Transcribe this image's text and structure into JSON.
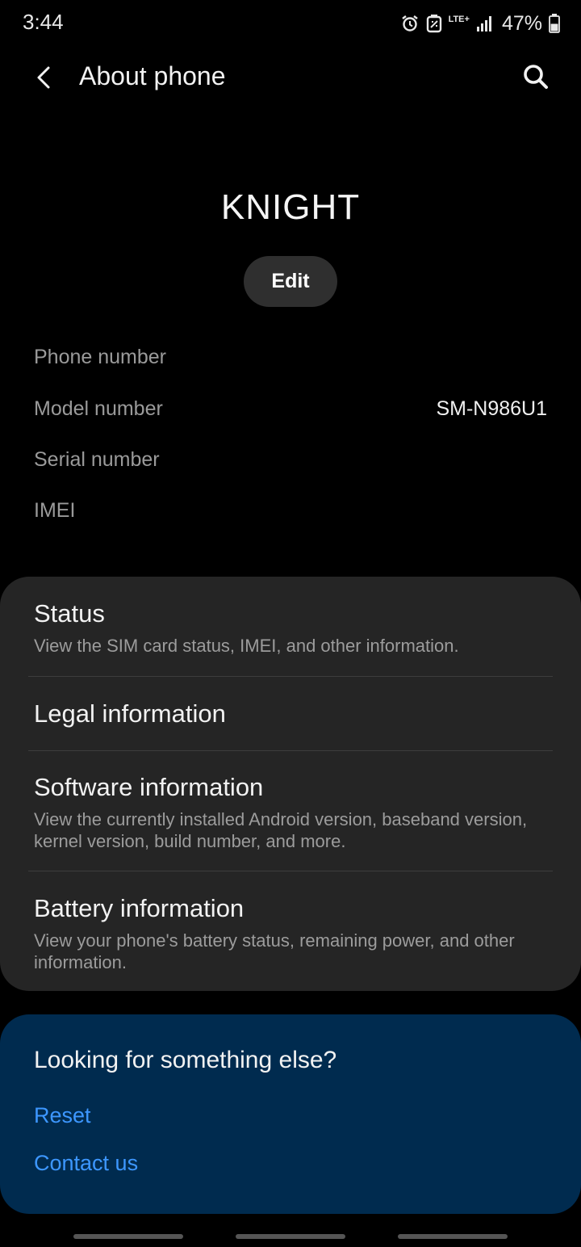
{
  "status_bar": {
    "time": "3:44",
    "network": "LTE+",
    "battery": "47%"
  },
  "header": {
    "title": "About phone"
  },
  "device": {
    "name": "KNIGHT",
    "edit_label": "Edit"
  },
  "info": [
    {
      "label": "Phone number",
      "value": ""
    },
    {
      "label": "Model number",
      "value": "SM-N986U1"
    },
    {
      "label": "Serial number",
      "value": ""
    },
    {
      "label": "IMEI",
      "value": ""
    }
  ],
  "menu": [
    {
      "title": "Status",
      "subtitle": "View the SIM card status, IMEI, and other information."
    },
    {
      "title": "Legal information",
      "subtitle": ""
    },
    {
      "title": "Software information",
      "subtitle": "View the currently installed Android version, baseband version, kernel version, build number, and more."
    },
    {
      "title": "Battery information",
      "subtitle": "View your phone's battery status, remaining power, and other information."
    }
  ],
  "help": {
    "title": "Looking for something else?",
    "links": [
      "Reset",
      "Contact us"
    ]
  },
  "colors": {
    "background": "#000000",
    "card": "#252525",
    "help_card": "#002b4f",
    "link": "#3d97ff"
  }
}
